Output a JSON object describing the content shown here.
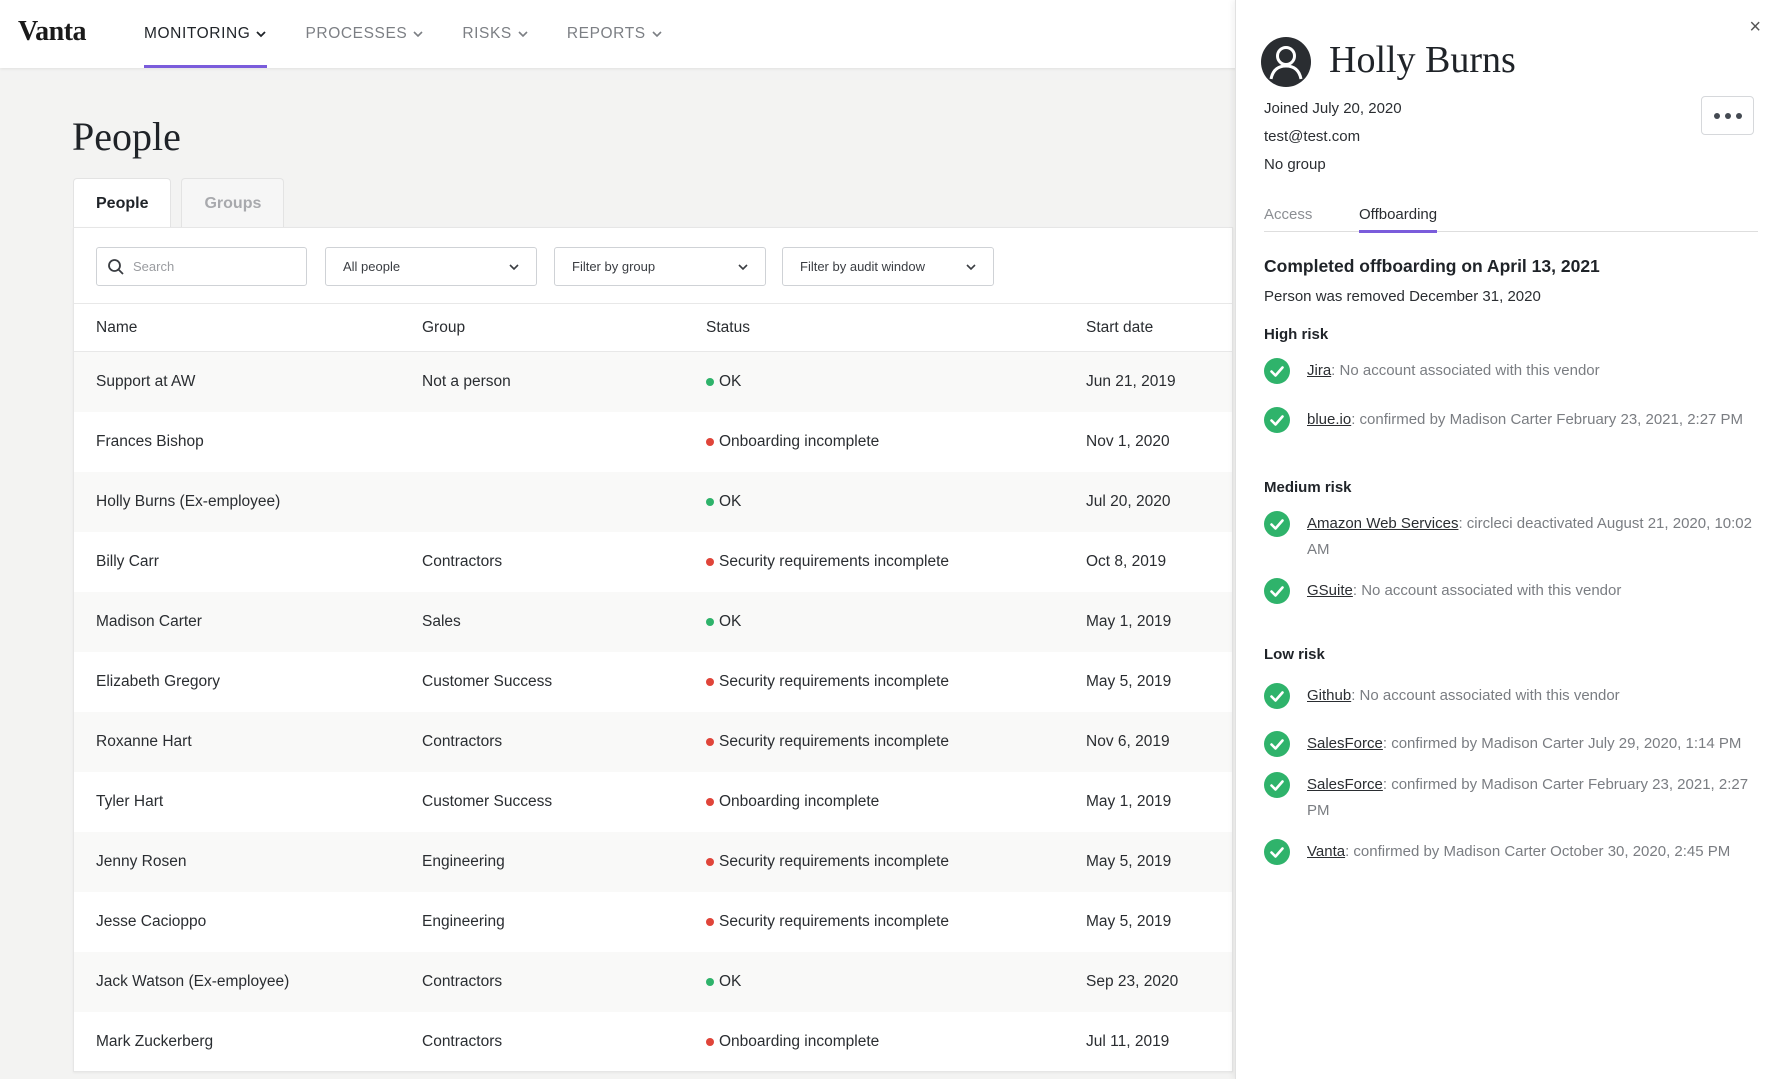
{
  "app": {
    "logo": "Vanta",
    "nav": [
      {
        "label": "MONITORING",
        "active": true
      },
      {
        "label": "PROCESSES",
        "active": false
      },
      {
        "label": "RISKS",
        "active": false
      },
      {
        "label": "REPORTS",
        "active": false
      }
    ]
  },
  "page": {
    "title": "People",
    "tabs": [
      {
        "label": "People",
        "active": true
      },
      {
        "label": "Groups",
        "active": false
      }
    ],
    "filters": {
      "search_placeholder": "Search",
      "people_select": "All people",
      "group_select": "Filter by group",
      "audit_select": "Filter by audit window"
    },
    "table": {
      "columns": [
        "Name",
        "Group",
        "Status",
        "Start date"
      ],
      "rows": [
        {
          "name": "Support at AW",
          "group": "Not a person",
          "status": "OK",
          "ok": true,
          "start": "Jun 21, 2019"
        },
        {
          "name": "Frances Bishop",
          "group": "",
          "status": "Onboarding incomplete",
          "ok": false,
          "start": "Nov 1, 2020"
        },
        {
          "name": "Holly Burns (Ex-employee)",
          "group": "",
          "status": "OK",
          "ok": true,
          "start": "Jul 20, 2020"
        },
        {
          "name": "Billy Carr",
          "group": "Contractors",
          "status": "Security requirements incomplete",
          "ok": false,
          "start": "Oct 8, 2019"
        },
        {
          "name": "Madison Carter",
          "group": "Sales",
          "status": "OK",
          "ok": true,
          "start": "May 1, 2019"
        },
        {
          "name": "Elizabeth Gregory",
          "group": "Customer Success",
          "status": "Security requirements incomplete",
          "ok": false,
          "start": "May 5, 2019"
        },
        {
          "name": "Roxanne Hart",
          "group": "Contractors",
          "status": "Security requirements incomplete",
          "ok": false,
          "start": "Nov 6, 2019"
        },
        {
          "name": "Tyler Hart",
          "group": "Customer Success",
          "status": "Onboarding incomplete",
          "ok": false,
          "start": "May 1, 2019"
        },
        {
          "name": "Jenny Rosen",
          "group": "Engineering",
          "status": "Security requirements incomplete",
          "ok": false,
          "start": "May 5, 2019"
        },
        {
          "name": "Jesse Cacioppo",
          "group": "Engineering",
          "status": "Security requirements incomplete",
          "ok": false,
          "start": "May 5, 2019"
        },
        {
          "name": "Jack Watson (Ex-employee)",
          "group": "Contractors",
          "status": "OK",
          "ok": true,
          "start": "Sep 23, 2020"
        },
        {
          "name": "Mark Zuckerberg",
          "group": "Contractors",
          "status": "Onboarding incomplete",
          "ok": false,
          "start": "Jul 11, 2019"
        }
      ]
    }
  },
  "panel": {
    "close_label": "×",
    "name": "Holly Burns",
    "joined": "Joined July 20, 2020",
    "email": "test@test.com",
    "group": "No group",
    "tabs": [
      {
        "label": "Access",
        "active": false
      },
      {
        "label": "Offboarding",
        "active": true
      }
    ],
    "completed": "Completed offboarding on April 13, 2021",
    "removed": "Person was removed December 31, 2020",
    "sections": [
      {
        "title": "High risk",
        "items": [
          {
            "vendor": "Jira",
            "detail": ": No account associated with this vendor"
          },
          {
            "vendor": "blue.io",
            "detail": ": confirmed by Madison Carter February 23, 2021, 2:27 PM"
          }
        ]
      },
      {
        "title": "Medium risk",
        "items": [
          {
            "vendor": "Amazon Web Services",
            "detail": ": circleci deactivated August 21, 2020, 10:02 AM"
          },
          {
            "vendor": "GSuite",
            "detail": ": No account associated with this vendor"
          }
        ]
      },
      {
        "title": "Low risk",
        "items": [
          {
            "vendor": "Github",
            "detail": ": No account associated with this vendor"
          },
          {
            "vendor": "SalesForce",
            "detail": ": confirmed by Madison Carter July 29, 2020, 1:14 PM"
          },
          {
            "vendor": "SalesForce",
            "detail": ": confirmed by Madison Carter February 23, 2021, 2:27 PM"
          },
          {
            "vendor": "Vanta",
            "detail": ": confirmed by Madison Carter October 30, 2020, 2:45 PM"
          }
        ]
      }
    ]
  },
  "colors": {
    "accent": "#7a5cdb",
    "ok": "#2fb36b",
    "error": "#e0453a",
    "check": "#2fb36b"
  }
}
